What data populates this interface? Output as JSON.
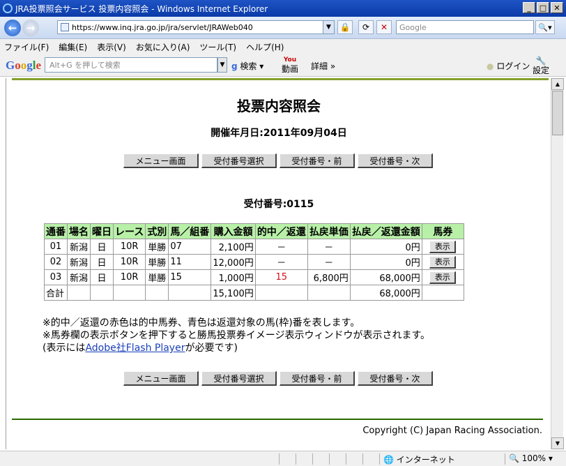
{
  "window": {
    "title": "JRA投票照会サービス 投票内容照会 - Windows Internet Explorer"
  },
  "browser": {
    "url": "https://www.inq.jra.go.jp/jra/servlet/JRAWeb040",
    "search_placeholder": "Google",
    "menu": [
      "ファイル(F)",
      "編集(E)",
      "表示(V)",
      "お気に入り(A)",
      "ツール(T)",
      "ヘルプ(H)"
    ],
    "google_input_placeholder": "Alt+G を押して検索",
    "search_label": "検索",
    "video_label": "動画",
    "details_label": "詳細 »",
    "login_label": "ログイン",
    "settings_label": "設定"
  },
  "page": {
    "title": "投票内容照会",
    "date_line": "開催年月日:2011年09月04日",
    "buttons": [
      "メニュー画面",
      "受付番号選択",
      "受付番号・前",
      "受付番号・次"
    ],
    "receipt_line": "受付番号:0115",
    "table": {
      "headers": [
        "通番",
        "場名",
        "曜日",
        "レース",
        "式別",
        "馬／組番",
        "購入金額",
        "的中／返還",
        "払戻単価",
        "払戻／返還金額",
        "馬券"
      ],
      "rows": [
        {
          "no": "01",
          "venue": "新潟",
          "day": "日",
          "race": "10R",
          "type": "単勝",
          "combo": "07",
          "amount": "2,100円",
          "hit": "－",
          "unit": "－",
          "payout": "0円",
          "ticket": "表示"
        },
        {
          "no": "02",
          "venue": "新潟",
          "day": "日",
          "race": "10R",
          "type": "単勝",
          "combo": "11",
          "amount": "12,000円",
          "hit": "－",
          "unit": "－",
          "payout": "0円",
          "ticket": "表示"
        },
        {
          "no": "03",
          "venue": "新潟",
          "day": "日",
          "race": "10R",
          "type": "単勝",
          "combo": "15",
          "amount": "1,000円",
          "hit": "15",
          "unit": "6,800円",
          "payout": "68,000円",
          "ticket": "表示"
        }
      ],
      "total": {
        "label": "合計",
        "amount": "15,100円",
        "payout": "68,000円"
      }
    },
    "notes": [
      "※的中／返還の赤色は的中馬券、青色は返還対象の馬(枠)番を表します。",
      "※馬券欄の表示ボタンを押下すると勝馬投票券イメージ表示ウィンドウが表示されます。"
    ],
    "note3_prefix": "(表示には",
    "note3_link": "Adobe社Flash Player",
    "note3_suffix": "が必要です)",
    "copyright": "Copyright (C) Japan Racing Association."
  },
  "status": {
    "zone": "インターネット",
    "zoom": "100%"
  },
  "colors": {
    "header_bg": "#b8f0a8",
    "hit_red": "#d0101a",
    "top_rule": "#84a02a",
    "bottom_rule": "#2a6a00"
  }
}
